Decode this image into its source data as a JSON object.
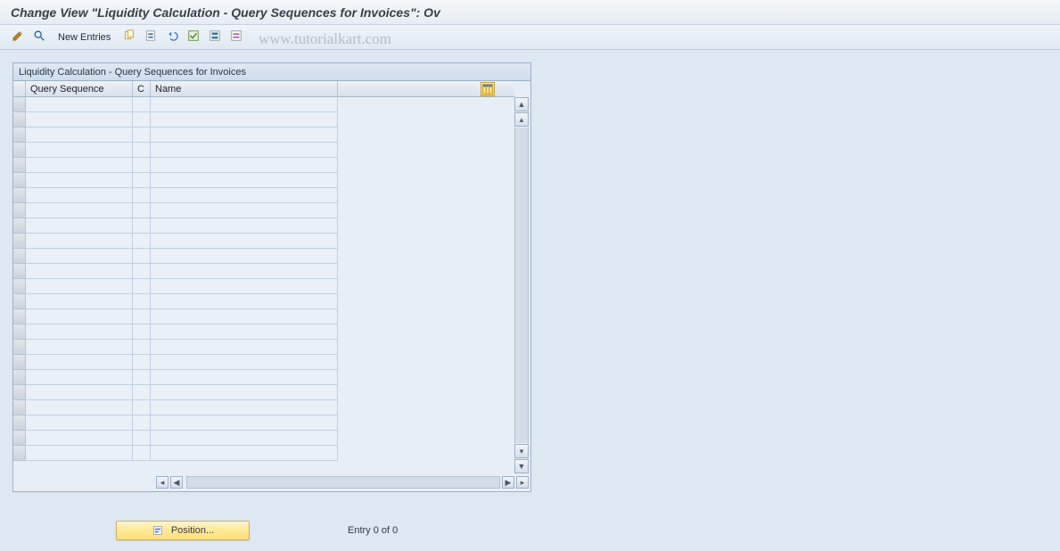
{
  "title": "Change View \"Liquidity Calculation - Query Sequences for Invoices\": Ov",
  "watermark": "www.tutorialkart.com",
  "toolbar": {
    "new_entries_label": "New Entries"
  },
  "panel": {
    "title": "Liquidity Calculation - Query Sequences for Invoices"
  },
  "table": {
    "columns": {
      "query_sequence": "Query Sequence",
      "c": "C",
      "name": "Name"
    },
    "row_count": 24
  },
  "footer": {
    "position_label": "Position...",
    "status": "Entry 0 of 0"
  },
  "icons": {
    "toggle": "toggle-display-change-icon",
    "details": "details-icon",
    "copy": "copy-icon",
    "delete": "delete-icon",
    "undo": "undo-icon",
    "select_all": "select-all-icon",
    "select_block": "select-block-icon",
    "deselect_all": "deselect-all-icon",
    "config": "table-settings-icon",
    "locate": "locate-icon"
  }
}
